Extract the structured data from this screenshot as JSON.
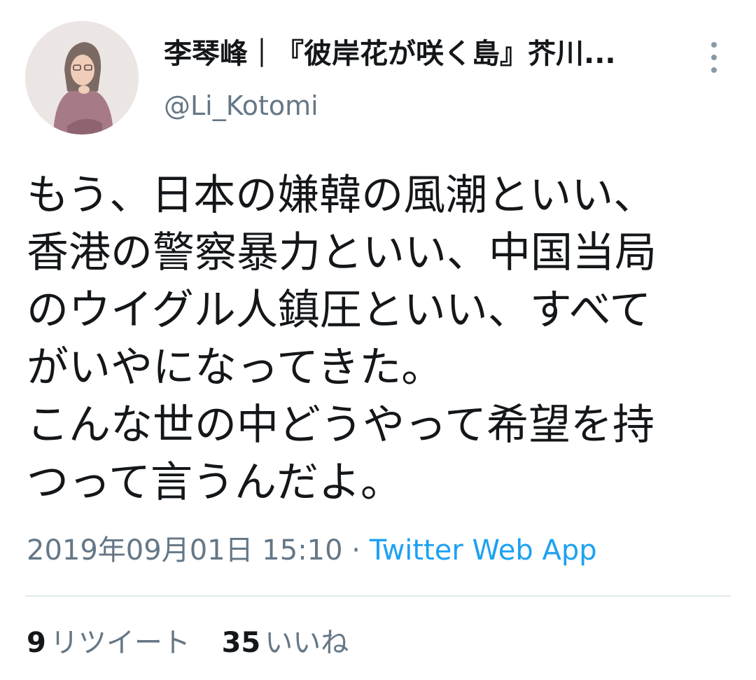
{
  "tweet": {
    "avatar_icon": "user-avatar-photo",
    "display_name": "李琴峰｜『彼岸花が咲く島』芥川...",
    "handle": "@Li_Kotomi",
    "more_icon": "more-vertical-icon",
    "text": "もう、日本の嫌韓の風潮といい、\n香港の警察暴力といい、中国当局\nのウイグル人鎮圧といい、すべて\nがいやになってきた。\nこんな世の中どうやって希望を持\nつって言うんだよ。",
    "timestamp": "2019年09月01日 15:10",
    "separator": " · ",
    "source": "Twitter Web App"
  },
  "stats": {
    "retweets": {
      "count": "9",
      "label": "リツイート"
    },
    "likes": {
      "count": "35",
      "label": "いいね"
    }
  },
  "colors": {
    "text": "#14171a",
    "secondary": "#657786",
    "link": "#1da1f2",
    "divider": "#e1e8ed"
  }
}
